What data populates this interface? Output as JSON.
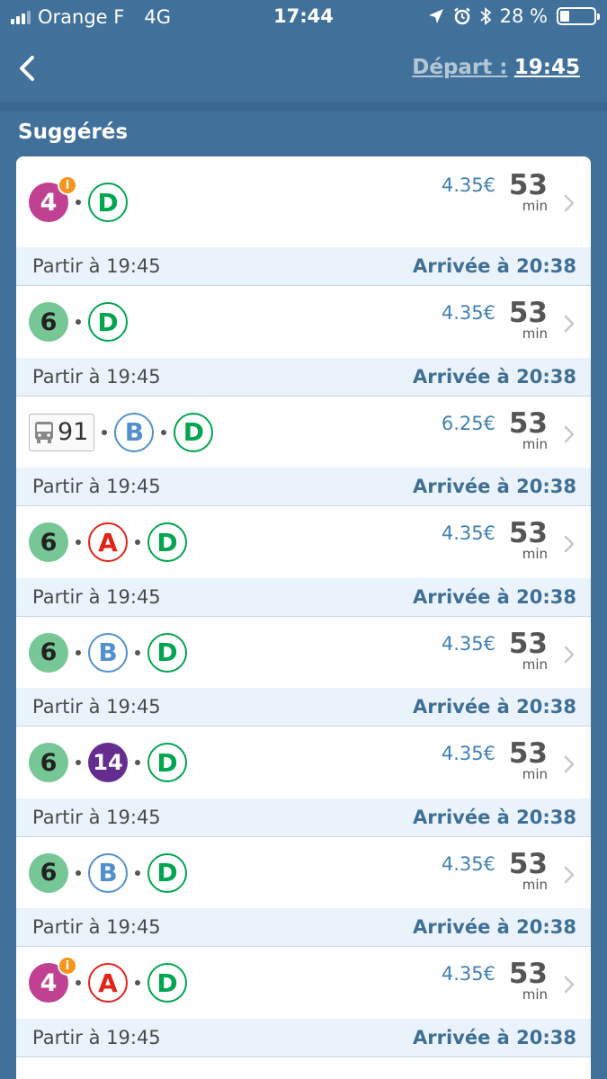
{
  "status": {
    "carrier": "Orange F",
    "network": "4G",
    "time": "17:44",
    "battery": "28 %",
    "battery_level": 0.28
  },
  "nav": {
    "depart_label": "Départ :",
    "depart_time": "19:45"
  },
  "section_title": "Suggérés",
  "routes": [
    {
      "lines": [
        {
          "type": "metro",
          "label": "4",
          "color": "#c04191",
          "info": true
        },
        {
          "type": "rer",
          "label": "D",
          "color": "#00a550"
        }
      ],
      "price": "4.35€",
      "duration": "53",
      "unit": "min",
      "depart": "Partir à 19:45",
      "arrival": "Arrivée à 20:38"
    },
    {
      "lines": [
        {
          "type": "metro",
          "label": "6",
          "color": "#76c696"
        },
        {
          "type": "rer",
          "label": "D",
          "color": "#00a550"
        }
      ],
      "price": "4.35€",
      "duration": "53",
      "unit": "min",
      "depart": "Partir à 19:45",
      "arrival": "Arrivée à 20:38"
    },
    {
      "lines": [
        {
          "type": "bus",
          "label": "91",
          "icon": "bus-icon"
        },
        {
          "type": "rer",
          "label": "B",
          "color": "#5291ce"
        },
        {
          "type": "rer",
          "label": "D",
          "color": "#00a550"
        }
      ],
      "price": "6.25€",
      "duration": "53",
      "unit": "min",
      "depart": "Partir à 19:45",
      "arrival": "Arrivée à 20:38"
    },
    {
      "lines": [
        {
          "type": "metro",
          "label": "6",
          "color": "#76c696"
        },
        {
          "type": "rer",
          "label": "A",
          "color": "#e2231a"
        },
        {
          "type": "rer",
          "label": "D",
          "color": "#00a550"
        }
      ],
      "price": "4.35€",
      "duration": "53",
      "unit": "min",
      "depart": "Partir à 19:45",
      "arrival": "Arrivée à 20:38"
    },
    {
      "lines": [
        {
          "type": "metro",
          "label": "6",
          "color": "#76c696"
        },
        {
          "type": "rer",
          "label": "B",
          "color": "#5291ce"
        },
        {
          "type": "rer",
          "label": "D",
          "color": "#00a550"
        }
      ],
      "price": "4.35€",
      "duration": "53",
      "unit": "min",
      "depart": "Partir à 19:45",
      "arrival": "Arrivée à 20:38"
    },
    {
      "lines": [
        {
          "type": "metro",
          "label": "6",
          "color": "#76c696"
        },
        {
          "type": "metro",
          "label": "14",
          "color": "#662d91"
        },
        {
          "type": "rer",
          "label": "D",
          "color": "#00a550"
        }
      ],
      "price": "4.35€",
      "duration": "53",
      "unit": "min",
      "depart": "Partir à 19:45",
      "arrival": "Arrivée à 20:38"
    },
    {
      "lines": [
        {
          "type": "metro",
          "label": "6",
          "color": "#76c696"
        },
        {
          "type": "rer",
          "label": "B",
          "color": "#5291ce"
        },
        {
          "type": "rer",
          "label": "D",
          "color": "#00a550"
        }
      ],
      "price": "4.35€",
      "duration": "53",
      "unit": "min",
      "depart": "Partir à 19:45",
      "arrival": "Arrivée à 20:38"
    },
    {
      "lines": [
        {
          "type": "metro",
          "label": "4",
          "color": "#c04191",
          "info": true
        },
        {
          "type": "rer",
          "label": "A",
          "color": "#e2231a"
        },
        {
          "type": "rer",
          "label": "D",
          "color": "#00a550"
        }
      ],
      "price": "4.35€",
      "duration": "53",
      "unit": "min",
      "depart": "Partir à 19:45",
      "arrival": "Arrivée à 20:38"
    }
  ]
}
